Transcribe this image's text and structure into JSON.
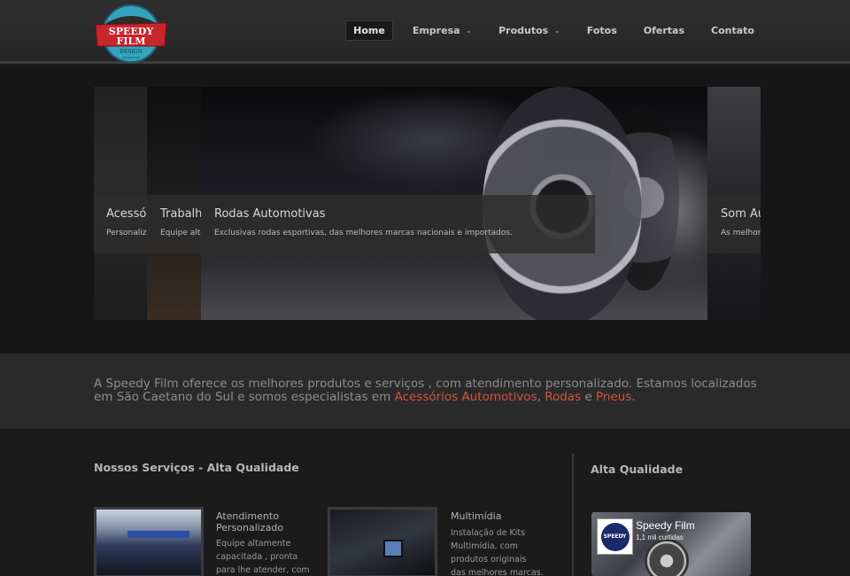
{
  "header": {
    "logo": {
      "line1": "SPEEDY",
      "line2": "FILM",
      "line3": "DESIGN",
      "line4": "AUTOMOTIVO"
    },
    "nav": [
      {
        "label": "Home",
        "active": true,
        "dropdown": false
      },
      {
        "label": "Empresa",
        "active": false,
        "dropdown": true
      },
      {
        "label": "Produtos",
        "active": false,
        "dropdown": true
      },
      {
        "label": "Fotos",
        "active": false,
        "dropdown": false
      },
      {
        "label": "Ofertas",
        "active": false,
        "dropdown": false
      },
      {
        "label": "Contato",
        "active": false,
        "dropdown": false
      }
    ]
  },
  "slider": {
    "slides": [
      {
        "title": "Acessórios",
        "text": "Personaliz"
      },
      {
        "title": "Trabalho",
        "text": "Equipe alta"
      },
      {
        "title": "Rodas Automotivas",
        "text": "Exclusivas rodas esportivas, das melhores marcas nacionais e importados."
      },
      {
        "title": "Som Au",
        "text": "As melhor"
      }
    ]
  },
  "intro": {
    "text_before": "A Speedy Film oferece os melhores produtos e serviços , com atendimento personalizado. Estamos localizados em São Caetano do Sul e somos especialistas em ",
    "link1": "Acessórios Automotivos",
    "sep1": ", ",
    "link2": "Rodas",
    "sep2": " e ",
    "link3": "Pneus."
  },
  "services": {
    "title": "Nossos Serviços - Alta Qualidade",
    "items": [
      {
        "title": "Atendimento Personalizado",
        "text": "Equipe altamente capacitada , pronta para lhe atender, com"
      },
      {
        "title": "Multimídia",
        "text": "Instalação de Kits Multimídia, com produtos originais das melhores marcas."
      }
    ]
  },
  "aside": {
    "title": "Alta Qualidade",
    "facebook": {
      "name": "Speedy Film",
      "likes": "1,1 mil curtidas",
      "logo_text": "SPEEDY"
    }
  },
  "colors": {
    "accent": "#d2553a",
    "background": "#1b1b1b",
    "header": "#2b2b2b"
  }
}
